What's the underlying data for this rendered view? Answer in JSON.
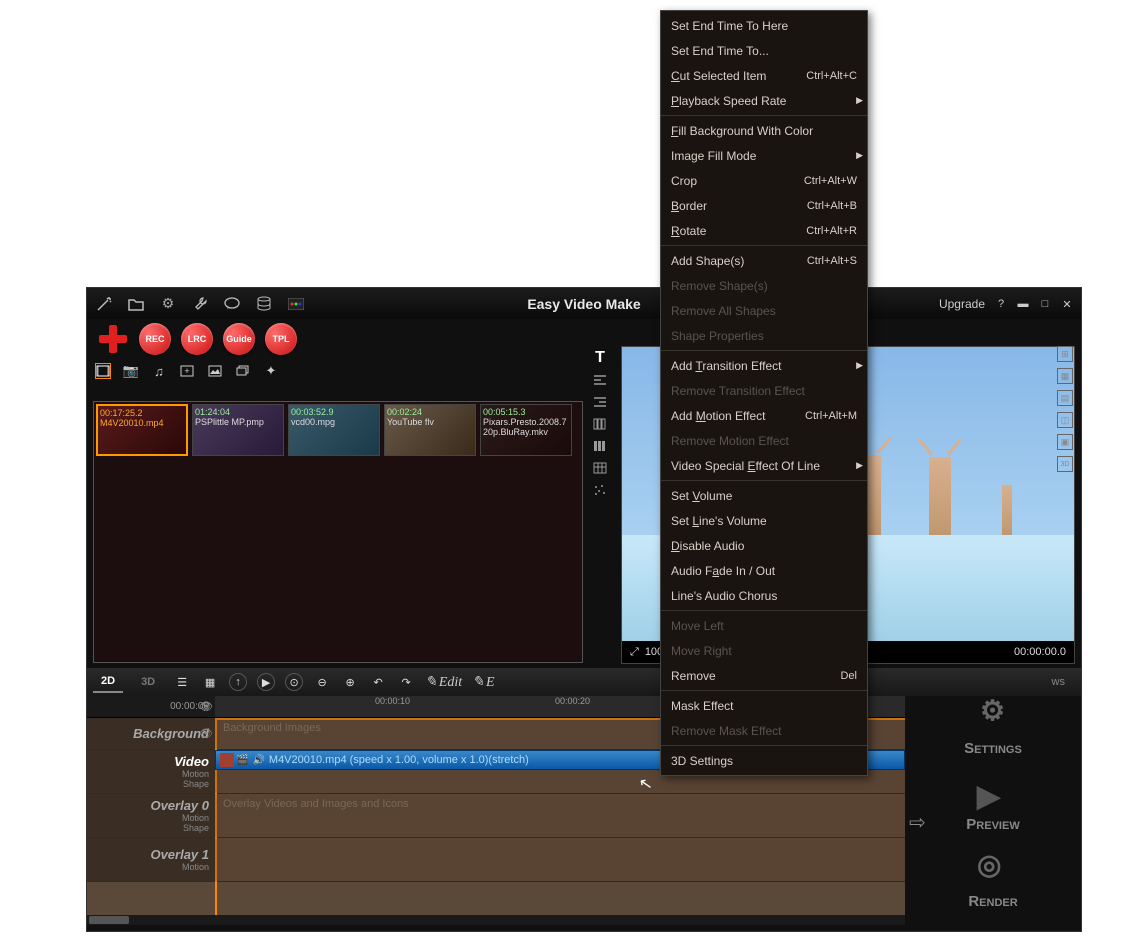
{
  "title": "Easy Video Make",
  "topRight": {
    "upgrade": "Upgrade"
  },
  "roundButtons": [
    "REC",
    "LRC",
    "Guide",
    "TPL"
  ],
  "mediaClips": [
    {
      "duration": "00:17:25.2",
      "name": "M4V20010.mp4",
      "cls": "c1",
      "selected": true
    },
    {
      "duration": "01:24:04",
      "name": "PSPlittle MP.pmp",
      "cls": "c2",
      "selected": false
    },
    {
      "duration": "00:03:52.9",
      "name": "vcd00.mpg",
      "cls": "c3",
      "selected": false
    },
    {
      "duration": "00:02:24",
      "name": "YouTube flv",
      "cls": "c4",
      "selected": false
    },
    {
      "duration": "00:05:15.3",
      "name": "Pixars.Presto.2008.720p.BluRay.mkv",
      "cls": "c5",
      "selected": false
    }
  ],
  "preview": {
    "zoom": "100%",
    "time": "00:00:00.0"
  },
  "tlTabs": {
    "a": "2D",
    "b": "3D"
  },
  "ruler": {
    "start": "00:00:00",
    "t1": "00:00:10",
    "t2": "00:00:20"
  },
  "editBtn1": "Edit",
  "editBtn2": "E",
  "wsLabel": "ws",
  "tracks": {
    "bg": {
      "name": "Background",
      "hint": "Background Images"
    },
    "video": {
      "name": "Video",
      "sub1": "Motion",
      "sub2": "Shape",
      "clipText": "M4V20010.mp4  (speed x 1.00, volume x 1.0)(stretch)"
    },
    "ov0": {
      "name": "Overlay 0",
      "sub1": "Motion",
      "sub2": "Shape",
      "hint": "Overlay Videos and Images and Icons"
    },
    "ov1": {
      "name": "Overlay 1",
      "sub1": "Motion"
    }
  },
  "actions": {
    "settings": "Settings",
    "preview": "Preview",
    "render": "Render"
  },
  "contextMenu": [
    {
      "label": "Set End Time To Here"
    },
    {
      "label": "Set End Time To..."
    },
    {
      "label": "Cut Selected Item",
      "ul": "C",
      "shortcut": "Ctrl+Alt+C"
    },
    {
      "label": "Playback Speed Rate",
      "ul": "P",
      "sub": true
    },
    {
      "sep": true
    },
    {
      "label": "Fill Background With Color",
      "ul": "F"
    },
    {
      "label": "Image Fill Mode",
      "sub": true
    },
    {
      "label": "Crop",
      "shortcut": "Ctrl+Alt+W"
    },
    {
      "label": "Border",
      "ul": "B",
      "shortcut": "Ctrl+Alt+B"
    },
    {
      "label": "Rotate",
      "ul": "R",
      "shortcut": "Ctrl+Alt+R"
    },
    {
      "sep": true
    },
    {
      "label": "Add Shape(s)",
      "shortcut": "Ctrl+Alt+S"
    },
    {
      "label": "Remove Shape(s)",
      "disabled": true
    },
    {
      "label": "Remove All Shapes",
      "disabled": true
    },
    {
      "label": "Shape Properties",
      "disabled": true
    },
    {
      "sep": true
    },
    {
      "label": "Add Transition Effect",
      "ul": "T",
      "sub": true
    },
    {
      "label": "Remove Transition Effect",
      "disabled": true
    },
    {
      "label": "Add Motion Effect",
      "ul": "M",
      "shortcut": "Ctrl+Alt+M"
    },
    {
      "label": "Remove Motion Effect",
      "disabled": true
    },
    {
      "label": "Video Special Effect Of Line",
      "ul": "E",
      "sub": true
    },
    {
      "sep": true
    },
    {
      "label": "Set Volume",
      "ul": "V"
    },
    {
      "label": "Set Line's Volume",
      "ul": "L"
    },
    {
      "label": "Disable Audio",
      "ul": "D"
    },
    {
      "label": "Audio Fade In / Out",
      "ul": "a"
    },
    {
      "label": "Line's Audio Chorus"
    },
    {
      "sep": true
    },
    {
      "label": "Move Left",
      "disabled": true
    },
    {
      "label": "Move Right",
      "disabled": true
    },
    {
      "label": "Remove",
      "shortcut": "Del"
    },
    {
      "sep": true
    },
    {
      "label": "Mask Effect"
    },
    {
      "label": "Remove Mask Effect",
      "disabled": true
    },
    {
      "sep": true
    },
    {
      "label": "3D Settings"
    }
  ]
}
